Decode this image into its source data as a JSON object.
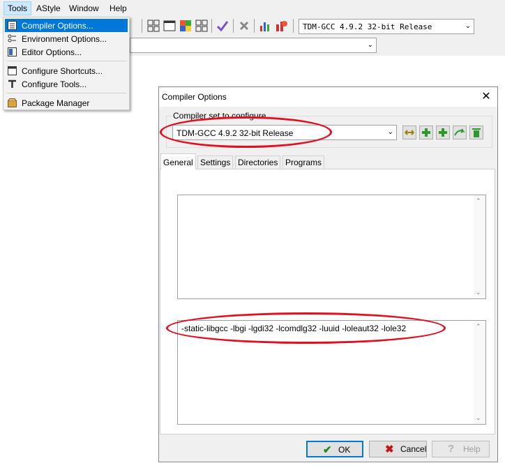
{
  "menubar": {
    "items": [
      "Tools",
      "AStyle",
      "Window",
      "Help"
    ]
  },
  "toolbar": {
    "compiler_combo": "TDM-GCC 4.9.2 32-bit Release",
    "second_combo": ""
  },
  "tools_menu": {
    "items": [
      {
        "label": "Compiler Options...",
        "icon": "compiler-options-icon"
      },
      {
        "label": "Environment Options...",
        "icon": "environment-options-icon"
      },
      {
        "label": "Editor Options...",
        "icon": "editor-options-icon"
      },
      {
        "label": "Configure Shortcuts...",
        "icon": "shortcuts-icon"
      },
      {
        "label": "Configure Tools...",
        "icon": "tools-icon"
      },
      {
        "label": "Package Manager",
        "icon": "package-icon"
      }
    ]
  },
  "dialog": {
    "title": "Compiler Options",
    "compiler_set_label": "Compiler set to configure",
    "compiler_set_value": "TDM-GCC 4.9.2 32-bit Release",
    "tabs": [
      "General",
      "Settings",
      "Directories",
      "Programs"
    ],
    "compiler_commands": "",
    "linker_commands": "-static-libgcc -lbgi -lgdi32 -lcomdlg32 -luuid -loleaut32 -lole32",
    "buttons": {
      "ok": "OK",
      "cancel": "Cancel",
      "help": "Help"
    }
  },
  "colors": {
    "highlight": "#0078d7",
    "annotation": "#e01020"
  }
}
